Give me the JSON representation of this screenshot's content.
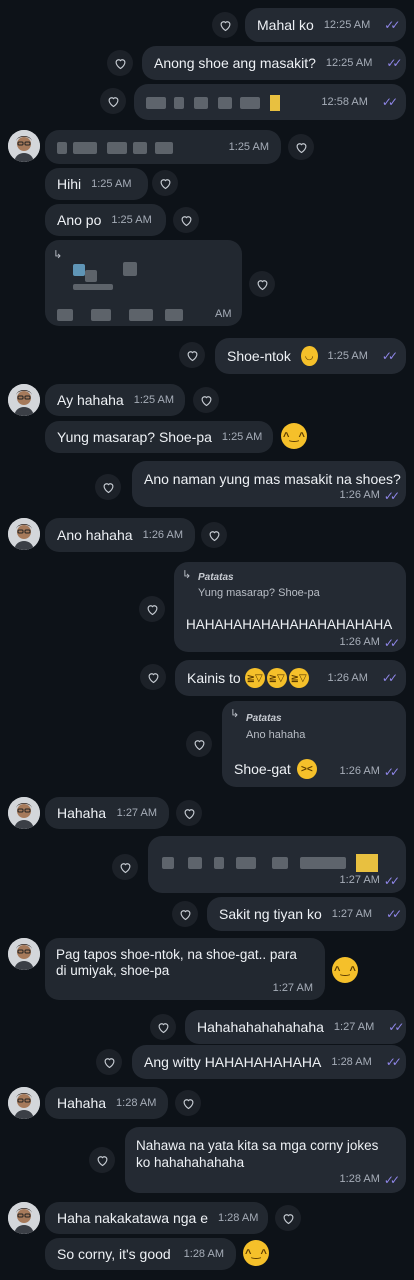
{
  "chat": {
    "ticks": "✓✓",
    "reply_arrow": "↳",
    "m1": {
      "text": "Mahal ko",
      "time": "12:25 AM"
    },
    "m2": {
      "text": "Anong shoe ang masakit?",
      "time": "12:25 AM"
    },
    "m3": {
      "time": "12:58 AM"
    },
    "m4": {
      "time": "1:25 AM"
    },
    "m5": {
      "text": "Hihi",
      "time": "1:25 AM"
    },
    "m6": {
      "text": "Ano po",
      "time": "1:25 AM"
    },
    "m7": {
      "time": "AM"
    },
    "m8": {
      "text": "Shoe-ntok",
      "time": "1:25 AM"
    },
    "m9": {
      "text": "Ay hahaha",
      "time": "1:25 AM"
    },
    "m10": {
      "text": "Yung masarap? Shoe-pa",
      "time": "1:25 AM"
    },
    "m11": {
      "text": "Ano naman yung mas masakit na shoes?",
      "time": "1:26 AM"
    },
    "m12": {
      "text": "Ano hahaha",
      "time": "1:26 AM"
    },
    "m13": {
      "quote_name": "Patatas",
      "quote_text": "Yung masarap? Shoe-pa",
      "text": "HAHAHAHAHAHAHAHAHAHAHA",
      "time": "1:26 AM"
    },
    "m14": {
      "text": "Kainis to",
      "time": "1:26 AM"
    },
    "m15": {
      "quote_name": "Patatas",
      "quote_text": "Ano hahaha",
      "text": "Shoe-gat",
      "time": "1:26 AM"
    },
    "m16": {
      "text": "Hahaha",
      "time": "1:27 AM"
    },
    "m17": {
      "time": "1:27 AM"
    },
    "m18": {
      "text": "Sakit ng tiyan ko",
      "time": "1:27 AM"
    },
    "m19": {
      "line1": "Pag tapos shoe-ntok, na shoe-gat.. para",
      "line2": "di umiyak, shoe-pa",
      "time": "1:27 AM"
    },
    "m20": {
      "text": "Hahahahahahahaha",
      "time": "1:27 AM"
    },
    "m21": {
      "text": "Ang witty HAHAHAHAHAHA",
      "time": "1:28 AM"
    },
    "m22": {
      "text": "Hahaha",
      "time": "1:28 AM"
    },
    "m23": {
      "line1": "Nahawa na yata kita sa mga corny jokes",
      "line2": "ko hahahahahaha",
      "time": "1:28 AM"
    },
    "m24": {
      "text": "Haha nakakatawa nga e",
      "time": "1:28 AM"
    },
    "m25": {
      "text": "So corny, it's good",
      "time": "1:28 AM"
    }
  },
  "colors": {
    "background": "#0d1218",
    "bubble": "#242a33",
    "read_ticks": "#8f86e8",
    "emoji": "#f5c02a"
  },
  "icons": {
    "heart": "heart-outline-icon",
    "laugh": "laughing-emoji-icon",
    "tears": "rolling-laughing-emoji-icon",
    "smile": "smiling-tear-emoji-icon",
    "grin": "grinning-squint-emoji-icon"
  }
}
